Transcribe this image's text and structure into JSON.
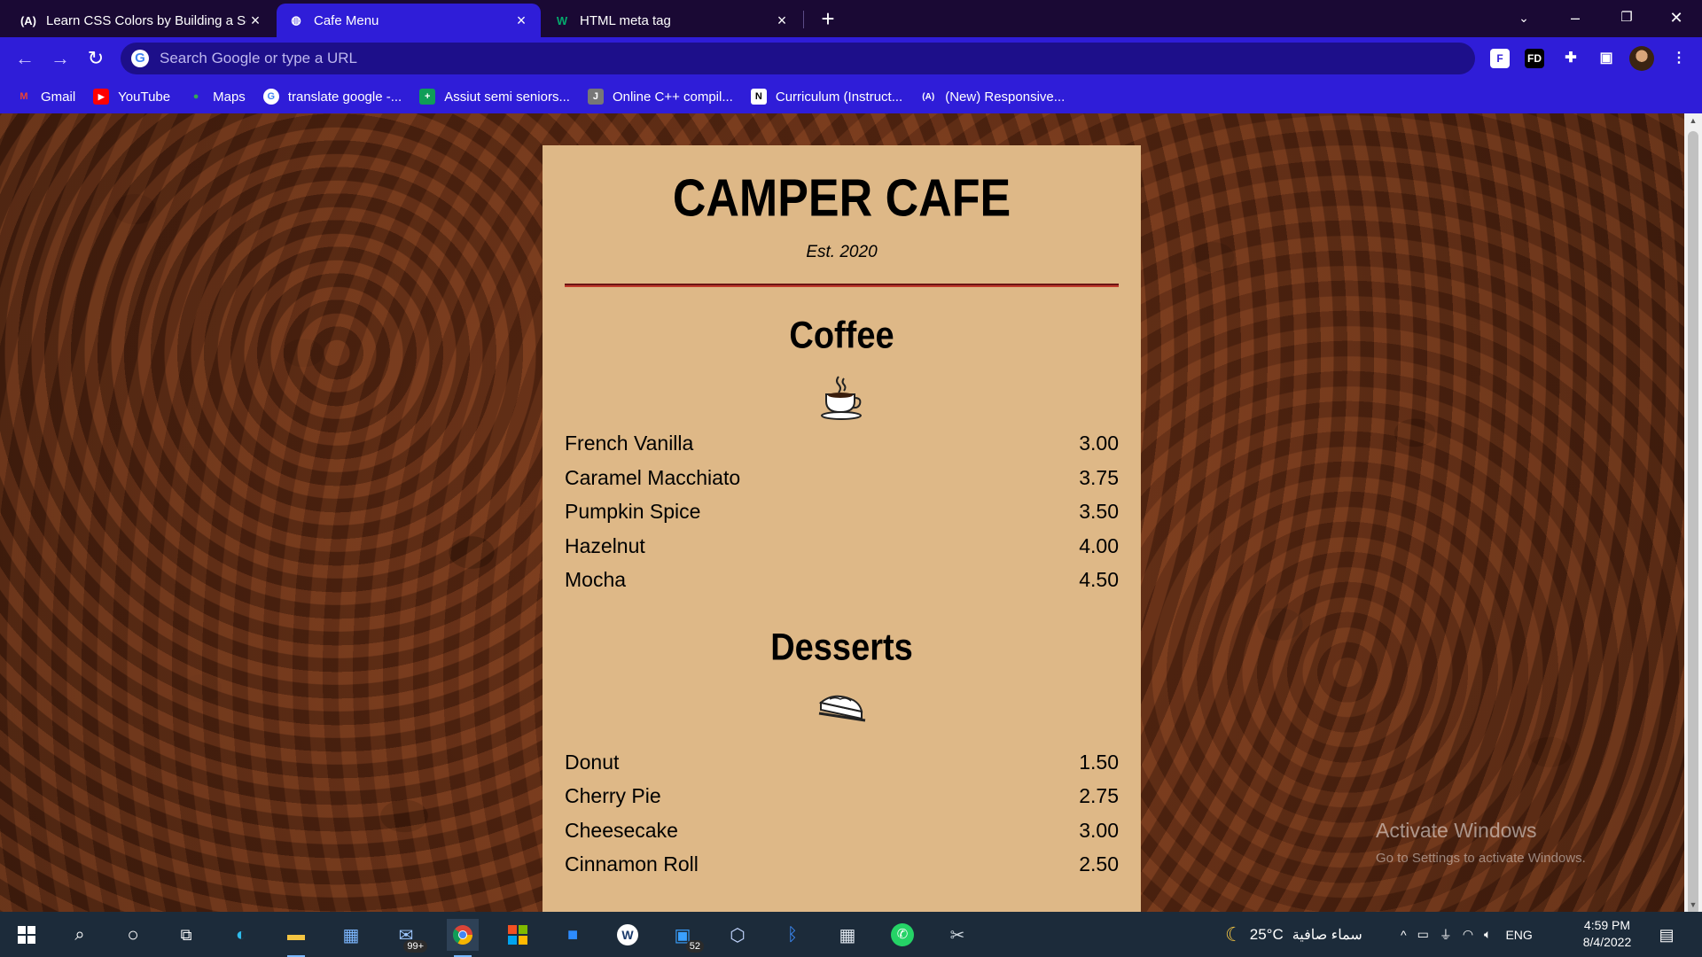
{
  "browser": {
    "tabs": [
      {
        "title": "Learn CSS Colors by Building a Se",
        "favicon": "freecodecamp-icon",
        "favicon_text": "(A)"
      },
      {
        "title": "Cafe Menu",
        "favicon": "globe-icon",
        "favicon_text": "◍"
      },
      {
        "title": "HTML meta tag",
        "favicon": "w3schools-icon",
        "favicon_text": "W"
      }
    ],
    "new_tab_label": "+",
    "omnibox_placeholder": "Search Google or type a URL",
    "bookmarks": [
      {
        "label": "Gmail",
        "icon": "gmail-icon",
        "glyph": "M",
        "color": "#ea4335"
      },
      {
        "label": "YouTube",
        "icon": "youtube-icon",
        "glyph": "▶",
        "color": "#ff0000"
      },
      {
        "label": "Maps",
        "icon": "maps-icon",
        "glyph": "●",
        "color": "#34a853"
      },
      {
        "label": "translate google -...",
        "icon": "google-icon",
        "glyph": "G",
        "color": "#ffffff"
      },
      {
        "label": "Assiut semi seniors...",
        "icon": "sheets-icon",
        "glyph": "+",
        "color": "#0f9d58"
      },
      {
        "label": "Online C++ compil...",
        "icon": "jdoodle-icon",
        "glyph": "J",
        "color": "#888888"
      },
      {
        "label": "Curriculum (Instruct...",
        "icon": "notion-icon",
        "glyph": "N",
        "color": "#ffffff"
      },
      {
        "label": "(New) Responsive...",
        "icon": "freecodecamp-icon",
        "glyph": "(A)",
        "color": "#ffffff"
      }
    ],
    "extensions": [
      "F",
      "FD",
      "✚",
      "▣"
    ]
  },
  "page": {
    "title": "CAMPER CAFE",
    "established": "Est. 2020",
    "sections": [
      {
        "name": "Coffee",
        "icon": "coffee-cup-icon",
        "items": [
          {
            "name": "French Vanilla",
            "price": "3.00"
          },
          {
            "name": "Caramel Macchiato",
            "price": "3.75"
          },
          {
            "name": "Pumpkin Spice",
            "price": "3.50"
          },
          {
            "name": "Hazelnut",
            "price": "4.00"
          },
          {
            "name": "Mocha",
            "price": "4.50"
          }
        ]
      },
      {
        "name": "Desserts",
        "icon": "pie-slice-icon",
        "items": [
          {
            "name": "Donut",
            "price": "1.50"
          },
          {
            "name": "Cherry Pie",
            "price": "2.75"
          },
          {
            "name": "Cheesecake",
            "price": "3.00"
          },
          {
            "name": "Cinnamon Roll",
            "price": "2.50"
          }
        ]
      }
    ],
    "colors": {
      "menu_bg": "#deb887",
      "rule": "#8b1a1a",
      "chrome": "#2f1dd8"
    }
  },
  "watermark": {
    "line1": "Activate Windows",
    "line2": "Go to Settings to activate Windows."
  },
  "taskbar": {
    "weather": "25°C",
    "weather_desc": "سماء صافية",
    "language": "ENG",
    "time": "4:59 PM",
    "date": "8/4/2022",
    "mail_badge": "99+",
    "store_badge": "52"
  }
}
